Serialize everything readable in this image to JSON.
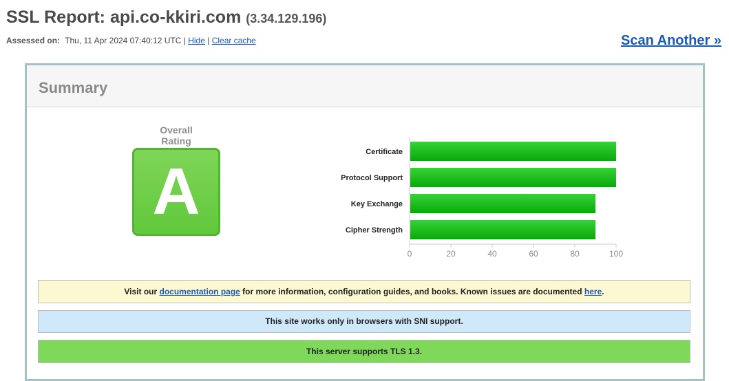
{
  "header": {
    "title_prefix": "SSL Report: ",
    "host": "api.co-kkiri.com",
    "ip": "(3.34.129.196)",
    "assessed_label": "Assessed on:",
    "assessed_value": "Thu, 11 Apr 2024 07:40:12 UTC",
    "separator": "|",
    "hide_link": "Hide",
    "clear_cache_link": "Clear cache",
    "scan_another": "Scan Another »"
  },
  "summary": {
    "title": "Summary",
    "overall_rating_label": "Overall Rating",
    "grade": "A",
    "grade_color": "#62c83c"
  },
  "chart_data": {
    "type": "bar",
    "orientation": "horizontal",
    "categories": [
      "Certificate",
      "Protocol Support",
      "Key Exchange",
      "Cipher Strength"
    ],
    "values": [
      100,
      100,
      90,
      90
    ],
    "xlim": [
      0,
      100
    ],
    "xticks": [
      "0",
      "20",
      "40",
      "60",
      "80",
      "100"
    ],
    "bar_color": "#1fbf1f",
    "grid": false,
    "title": "",
    "xlabel": "",
    "ylabel": ""
  },
  "notices": {
    "docs": {
      "prefix": "Visit our ",
      "link1": "documentation page",
      "middle": " for more information, configuration guides, and books. Known issues are documented ",
      "link2": "here",
      "suffix": "."
    },
    "sni": "This site works only in browsers with SNI support.",
    "tls": "This server supports TLS 1.3."
  }
}
